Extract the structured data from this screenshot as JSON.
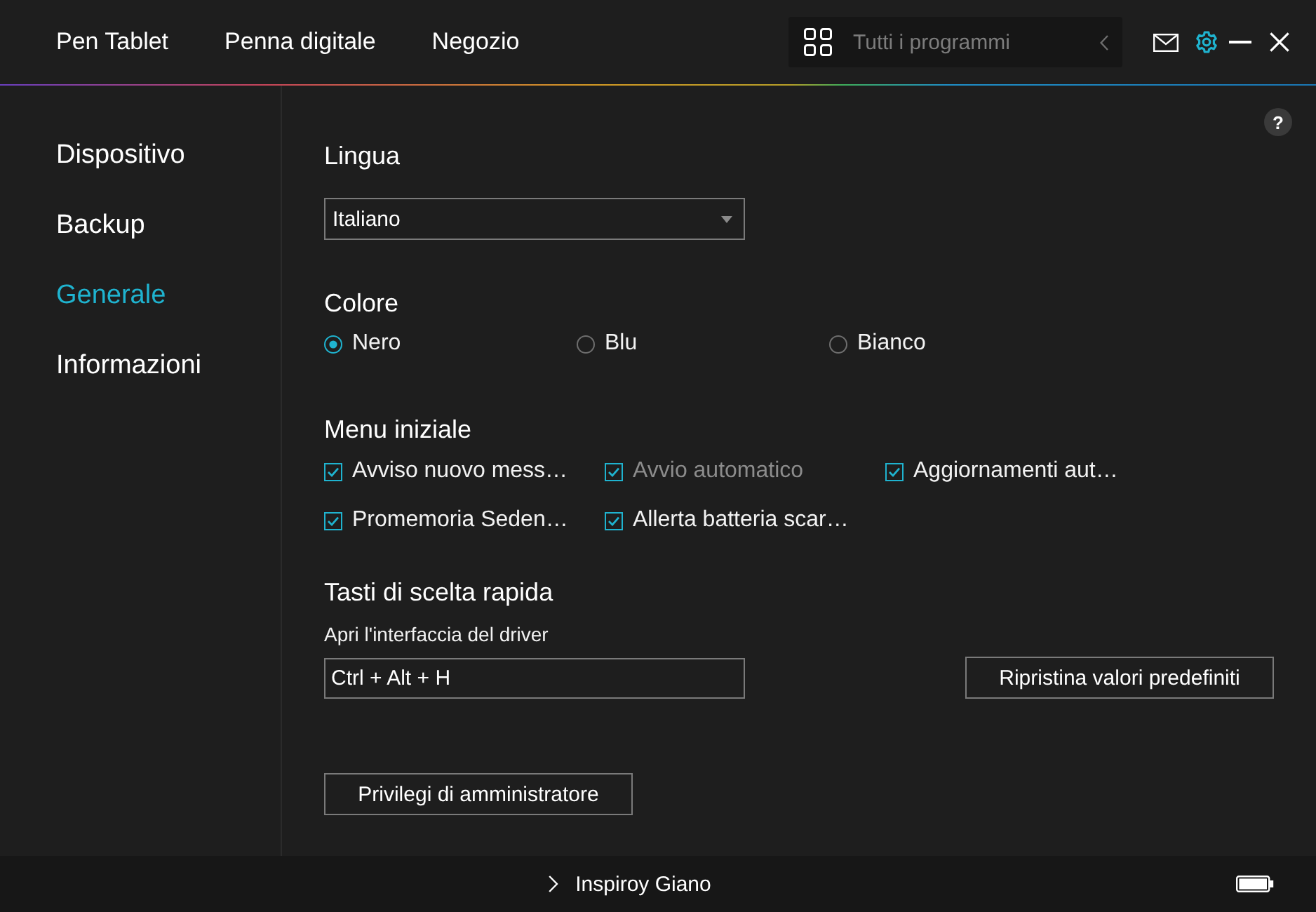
{
  "top_nav": {
    "items": [
      {
        "label": "Pen Tablet",
        "selected": false
      },
      {
        "label": "Penna digitale",
        "selected": false
      },
      {
        "label": "Negozio",
        "selected": false
      }
    ]
  },
  "search": {
    "placeholder": "Tutti i programmi"
  },
  "help_button": "?",
  "sidebar": {
    "items": [
      {
        "label": "Dispositivo",
        "selected": false
      },
      {
        "label": "Backup",
        "selected": false
      },
      {
        "label": "Generale",
        "selected": true
      },
      {
        "label": "Informazioni",
        "selected": false
      }
    ]
  },
  "language": {
    "title": "Lingua",
    "value": "Italiano"
  },
  "color": {
    "title": "Colore",
    "options": [
      {
        "label": "Nero",
        "selected": true
      },
      {
        "label": "Blu",
        "selected": false
      },
      {
        "label": "Bianco",
        "selected": false
      }
    ]
  },
  "startup_menu": {
    "title": "Menu iniziale",
    "options": [
      {
        "label": "Avviso nuovo mess…",
        "checked": true,
        "disabled": false
      },
      {
        "label": "Avvio automatico",
        "checked": true,
        "disabled": true
      },
      {
        "label": "Aggiornamenti aut…",
        "checked": true,
        "disabled": false
      },
      {
        "label": "Promemoria Seden…",
        "checked": true,
        "disabled": false
      },
      {
        "label": "Allerta batteria scar…",
        "checked": true,
        "disabled": false
      }
    ]
  },
  "shortcuts": {
    "title": "Tasti di scelta rapida",
    "field_label": "Apri l'interfaccia del driver",
    "value": "Ctrl + Alt + H",
    "reset_button": "Ripristina valori predefiniti"
  },
  "admin_button": "Privilegi di amministratore",
  "status_bar": {
    "device": "Inspiroy Giano"
  }
}
